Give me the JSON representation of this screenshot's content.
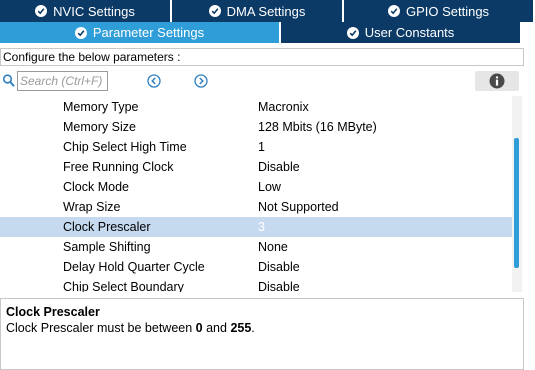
{
  "tabs": {
    "row1": [
      {
        "label": "NVIC Settings",
        "width": 172
      },
      {
        "label": "DMA Settings",
        "width": 172
      },
      {
        "label": "GPIO Settings",
        "width": 191
      }
    ],
    "row2": [
      {
        "label": "Parameter Settings",
        "width": 281,
        "active": true
      },
      {
        "label": "User Constants",
        "width": 241
      }
    ]
  },
  "configure_label": "Configure the below parameters :",
  "search": {
    "placeholder": "Search (Ctrl+F)"
  },
  "parameters": [
    {
      "name": "Memory Type",
      "value": "Macronix"
    },
    {
      "name": "Memory Size",
      "value": "128 Mbits (16 MByte)"
    },
    {
      "name": "Chip Select High Time",
      "value": "1"
    },
    {
      "name": "Free Running Clock",
      "value": "Disable"
    },
    {
      "name": "Clock Mode",
      "value": "Low"
    },
    {
      "name": "Wrap Size",
      "value": "Not Supported"
    },
    {
      "name": "Clock Prescaler",
      "value": "3",
      "selected": true
    },
    {
      "name": "Sample Shifting",
      "value": "None"
    },
    {
      "name": "Delay Hold Quarter Cycle",
      "value": "Disable"
    },
    {
      "name": "Chip Select Boundary",
      "value": "Disable"
    }
  ],
  "description": {
    "title": "Clock Prescaler",
    "text_before": "Clock Prescaler must be between ",
    "min": "0",
    "text_mid": " and ",
    "max": "255",
    "text_after": "."
  },
  "colors": {
    "tab_bg": "#0b3a67",
    "tab_active": "#2f9ed8",
    "selected_row": "#c5d9ef"
  }
}
